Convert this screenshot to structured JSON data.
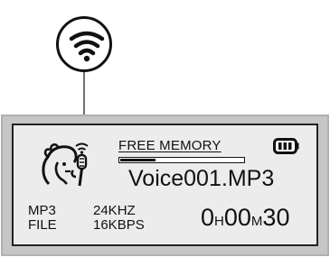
{
  "screen": {
    "memory_label": "FREE MEMORY",
    "memory_free_fraction": 0.28,
    "filename": "Voice001.MP3",
    "file_type": [
      "MP3",
      "FILE"
    ],
    "bitrate_info": [
      "24KHZ",
      "16KBPS"
    ],
    "time": {
      "hours": "0",
      "hours_unit": "H",
      "minutes": "00",
      "minutes_unit": "M",
      "seconds": "30"
    }
  },
  "icons": {
    "callout": "wifi-signal-icon",
    "mode": "voice-recording-icon",
    "battery": "battery-icon"
  }
}
